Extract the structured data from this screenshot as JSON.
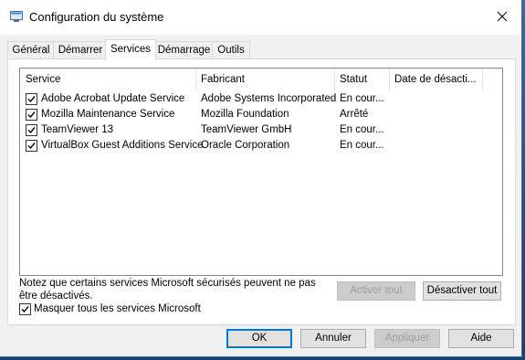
{
  "window": {
    "title": "Configuration du système"
  },
  "tabs": [
    {
      "label": "Général",
      "active": false
    },
    {
      "label": "Démarrer",
      "active": false
    },
    {
      "label": "Services",
      "active": true
    },
    {
      "label": "Démarrage",
      "active": false
    },
    {
      "label": "Outils",
      "active": false
    }
  ],
  "services": {
    "columns": [
      "Service",
      "Fabricant",
      "Statut",
      "Date de désacti..."
    ],
    "rows": [
      {
        "checked": true,
        "service": "Adobe Acrobat Update Service",
        "manufacturer": "Adobe Systems Incorporated",
        "status": "En cour..."
      },
      {
        "checked": true,
        "service": "Mozilla Maintenance Service",
        "manufacturer": "Mozilla Foundation",
        "status": "Arrêté"
      },
      {
        "checked": true,
        "service": "TeamViewer 13",
        "manufacturer": "TeamViewer GmbH",
        "status": "En cour..."
      },
      {
        "checked": true,
        "service": "VirtualBox Guest Additions Service",
        "manufacturer": "Oracle Corporation",
        "status": "En cour..."
      }
    ]
  },
  "notice": "Notez que certains services Microsoft sécurisés peuvent ne pas être désactivés.",
  "buttons": {
    "enable_all": "Activer tout",
    "disable_all": "Désactiver tout",
    "ok": "OK",
    "cancel": "Annuler",
    "apply": "Appliquer",
    "help": "Aide"
  },
  "hide_ms": {
    "label": "Masquer tous les services Microsoft",
    "checked": true
  },
  "colors": {
    "accent": "#0078d7",
    "desktop": "#1f5e9e"
  }
}
